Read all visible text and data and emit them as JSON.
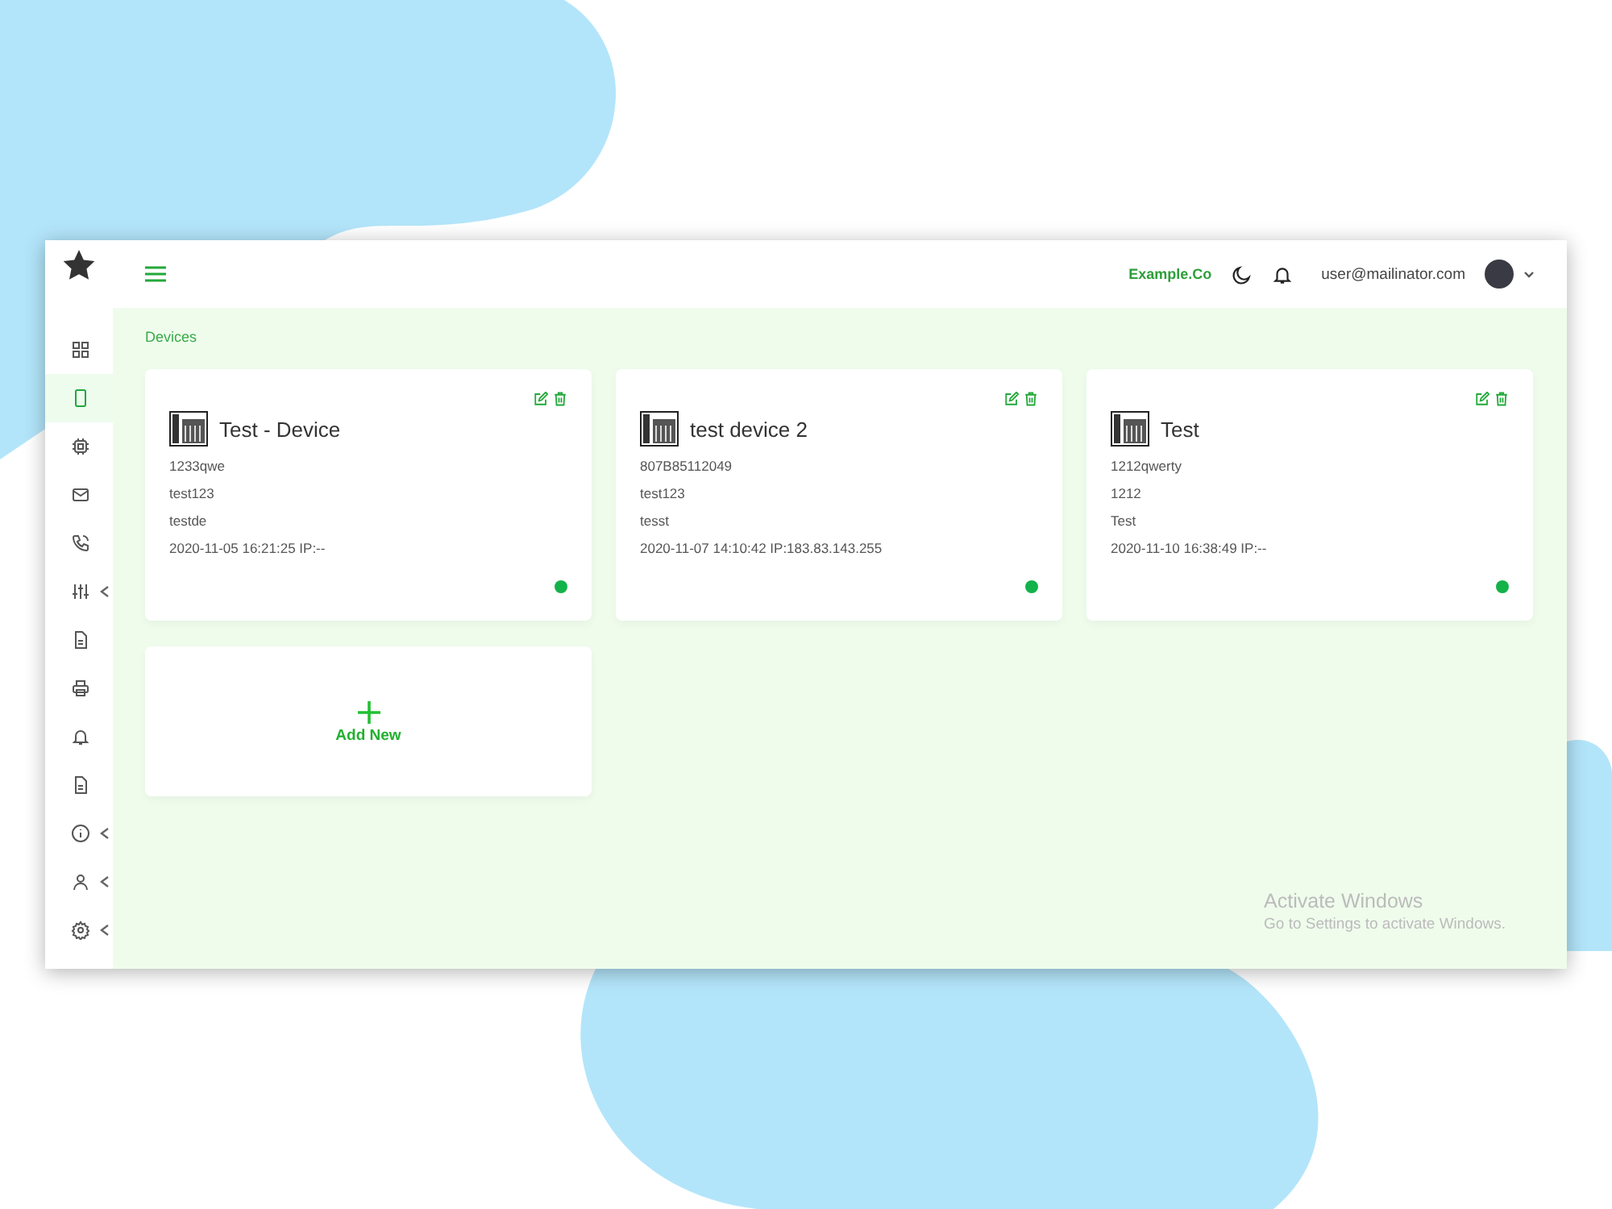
{
  "sidebar": {
    "items": [
      {
        "kind": "grid",
        "selected": false,
        "expandable": false
      },
      {
        "kind": "mobile",
        "selected": true,
        "expandable": false
      },
      {
        "kind": "chip",
        "selected": false,
        "expandable": false
      },
      {
        "kind": "mail",
        "selected": false,
        "expandable": false
      },
      {
        "kind": "call",
        "selected": false,
        "expandable": false
      },
      {
        "kind": "sliders",
        "selected": false,
        "expandable": true
      },
      {
        "kind": "file",
        "selected": false,
        "expandable": false
      },
      {
        "kind": "printer",
        "selected": false,
        "expandable": false
      },
      {
        "kind": "bell",
        "selected": false,
        "expandable": false
      },
      {
        "kind": "file",
        "selected": false,
        "expandable": false
      },
      {
        "kind": "info",
        "selected": false,
        "expandable": true
      },
      {
        "kind": "user",
        "selected": false,
        "expandable": true
      },
      {
        "kind": "gear",
        "selected": false,
        "expandable": true
      }
    ]
  },
  "header": {
    "company": "Example.Co",
    "user": "user@mailinator.com"
  },
  "breadcrumb": "Devices",
  "devices": [
    {
      "name": "Test - Device",
      "lines": [
        "1233qwe",
        "test123",
        "testde",
        "2020-11-05 16:21:25 IP:--"
      ],
      "online": true
    },
    {
      "name": "test device 2",
      "lines": [
        "807B85112049",
        "test123",
        "tesst",
        "2020-11-07 14:10:42 IP:183.83.143.255"
      ],
      "online": true
    },
    {
      "name": "Test",
      "lines": [
        "1212qwerty",
        "1212",
        "Test",
        "2020-11-10 16:38:49 IP:--"
      ],
      "online": true
    }
  ],
  "add_card": {
    "label": "Add New"
  },
  "os_notice": {
    "title": "Activate Windows",
    "text": "Go to Settings to activate Windows."
  }
}
